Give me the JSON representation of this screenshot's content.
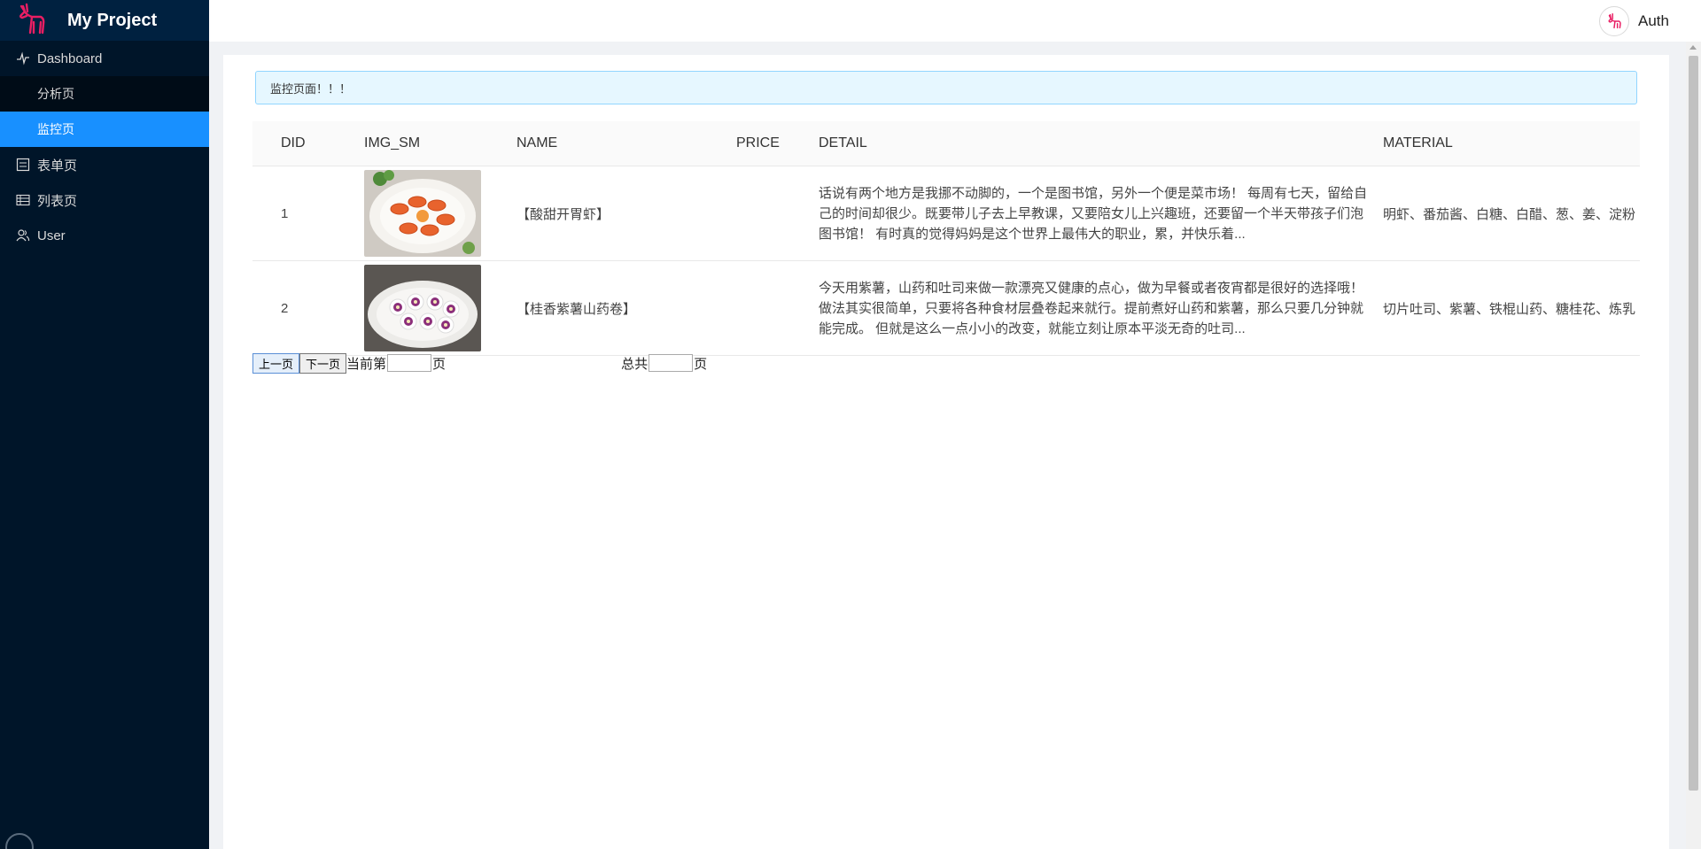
{
  "app": {
    "title": "My Project"
  },
  "sidebar": {
    "items": [
      {
        "label": "Dashboard",
        "icon": "pulse-icon"
      },
      {
        "label": "分析页",
        "icon": ""
      },
      {
        "label": "监控页",
        "icon": "",
        "selected": true
      },
      {
        "label": "表单页",
        "icon": "form-icon"
      },
      {
        "label": "列表页",
        "icon": "table-icon"
      },
      {
        "label": "User",
        "icon": "user-icon"
      }
    ]
  },
  "header": {
    "user_label": "Auth"
  },
  "alert": {
    "text": "监控页面！！！"
  },
  "table": {
    "columns": [
      "DID",
      "IMG_SM",
      "NAME",
      "PRICE",
      "DETAIL",
      "MATERIAL"
    ],
    "rows": [
      {
        "did": "1",
        "img": "shrimp-dish-image",
        "name": "【酸甜开胃虾】",
        "price": "",
        "detail": "话说有两个地方是我挪不动脚的，一个是图书馆，另外一个便是菜市场！ 每周有七天，留给自己的时间却很少。既要带儿子去上早教课，又要陪女儿上兴趣班，还要留一个半天带孩子们泡图书馆！ 有时真的觉得妈妈是这个世界上最伟大的职业，累，并快乐着...",
        "material": "明虾、番茄酱、白糖、白醋、葱、姜、淀粉"
      },
      {
        "did": "2",
        "img": "purple-potato-roll-image",
        "name": "【桂香紫薯山药卷】",
        "price": "",
        "detail": "今天用紫薯，山药和吐司来做一款漂亮又健康的点心，做为早餐或者夜宵都是很好的选择哦！ 做法其实很简单，只要将各种食材层叠卷起来就行。提前煮好山药和紫薯，那么只要几分钟就能完成。 但就是这么一点小小的改变，就能立刻让原本平淡无奇的吐司...",
        "material": "切片吐司、紫薯、铁棍山药、糖桂花、炼乳"
      }
    ]
  },
  "pager": {
    "prev_label": "上一页",
    "next_label": "下一页",
    "current_prefix": "当前第",
    "current_suffix": "页",
    "current_value": "",
    "total_prefix": "总共",
    "total_suffix": "页",
    "total_value": ""
  },
  "colors": {
    "sidebar_bg": "#001529",
    "accent": "#1890ff",
    "logo_pink": "#e91e63"
  }
}
